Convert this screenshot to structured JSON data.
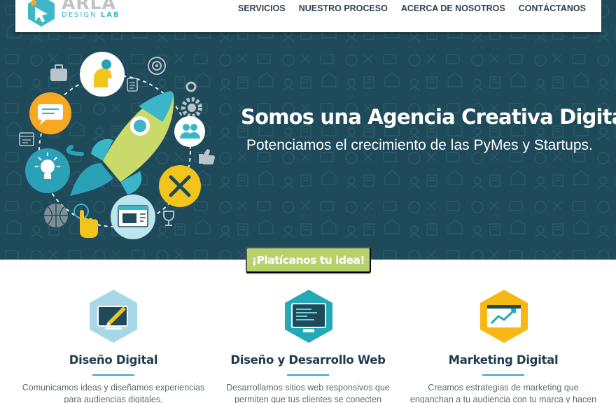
{
  "brand": {
    "name": "ARLA",
    "sub_prefix": "DESIGN",
    "sub_suffix": "LAB"
  },
  "nav": {
    "items": [
      {
        "label": "SERVICIOS"
      },
      {
        "label": "NUESTRO PROCESO"
      },
      {
        "label": "ACERCA DE NOSOTROS"
      },
      {
        "label": "CONTÁCTANOS"
      }
    ]
  },
  "hero": {
    "title": "Somos una Agencia Creativa Digital.",
    "subtitle": "Potenciamos el crecimiento de las PyMes y Startups.",
    "illustration_icons": [
      "briefcase-icon",
      "idea-head-icon",
      "target-icon",
      "checklist-icon",
      "chat-icon",
      "rocket-icon",
      "gear-icon",
      "users-icon",
      "browser-icon",
      "lightbulb-icon",
      "like-icon",
      "tools-icon",
      "globe-icon",
      "hand-click-icon",
      "web-page-icon",
      "trophy-icon"
    ]
  },
  "cta": {
    "label": "¡Platícanos tu idea!"
  },
  "services": [
    {
      "title": "Diseño Digital",
      "description": "Comunicamos ideas y diseñamos experiencias para audiencias digitales.",
      "icon": "design-tablet-icon",
      "color": "#a8d8e8"
    },
    {
      "title": "Diseño y Desarrollo Web",
      "description": "Desarrollamos sitios web responsivos que permiten que tus clientes se conecten rápidamente a tus",
      "icon": "code-window-icon",
      "color": "#24a9b6"
    },
    {
      "title": "Marketing Digital",
      "description": "Creamos estrategias de marketing que enganchan a tu audiencia con tu marca y hacen crecer tu",
      "icon": "growth-chart-icon",
      "color": "#f7b815"
    }
  ],
  "colors": {
    "hero_bg": "#1f4a5a",
    "accent_green": "#b5d36a",
    "accent_teal": "#3aa6c1",
    "nav_text": "#2f4252",
    "title_text": "#1f3b4f"
  }
}
